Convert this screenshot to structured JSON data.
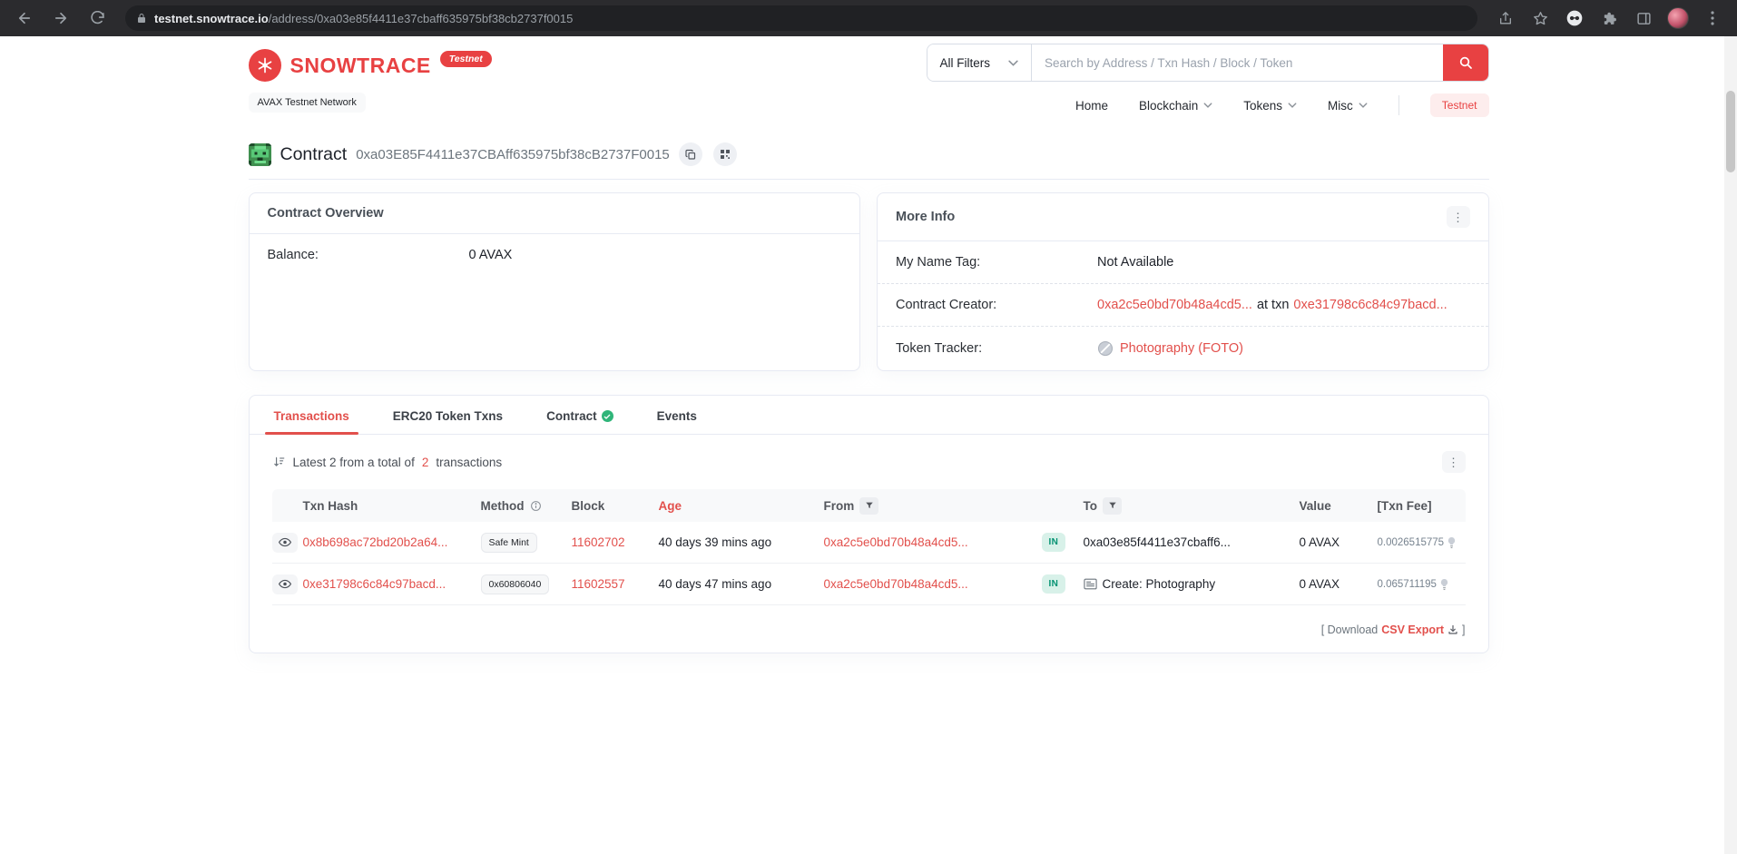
{
  "colors": {
    "brand_red": "#e84142",
    "link_red": "#e2504c",
    "in_badge_bg": "#d8f1e9",
    "in_badge_text": "#029171"
  },
  "browser": {
    "url_host": "testnet.snowtrace.io",
    "url_path": "/address/0xa03e85f4411e37cbaff635975bf38cb2737f0015"
  },
  "header": {
    "brand": "SNOWTRACE",
    "brand_badge": "Testnet",
    "network_label": "AVAX Testnet Network",
    "search": {
      "filter_label": "All Filters",
      "placeholder": "Search by Address / Txn Hash / Block / Token"
    },
    "nav": [
      {
        "label": "Home"
      },
      {
        "label": "Blockchain"
      },
      {
        "label": "Tokens"
      },
      {
        "label": "Misc"
      }
    ],
    "nav_testnet": "Testnet"
  },
  "page": {
    "title": "Contract",
    "address": "0xa03E85F4411e37CBAff635975bf38cB2737F0015"
  },
  "overview": {
    "title": "Contract Overview",
    "balance_label": "Balance:",
    "balance_value": "0 AVAX"
  },
  "more_info": {
    "title": "More Info",
    "dots_glyph": "⋮",
    "name_tag_label": "My Name Tag:",
    "name_tag_value": "Not Available",
    "creator_label": "Contract Creator:",
    "creator_address": "0xa2c5e0bd70b48a4cd5...",
    "creator_at_txn": "at txn",
    "creator_txn": "0xe31798c6c84c97bacd...",
    "tracker_label": "Token Tracker:",
    "tracker_value": "Photography (FOTO)"
  },
  "tabs": [
    {
      "label": "Transactions"
    },
    {
      "label": "ERC20 Token Txns"
    },
    {
      "label": "Contract"
    },
    {
      "label": "Events"
    }
  ],
  "transactions": {
    "summary_prefix": "Latest 2 from a total of",
    "summary_total": "2",
    "summary_suffix": "transactions",
    "dots_glyph": "⋮",
    "columns": {
      "txn_hash": "Txn Hash",
      "method": "Method",
      "block": "Block",
      "age": "Age",
      "from": "From",
      "to": "To",
      "value": "Value",
      "txn_fee": "[Txn Fee]"
    },
    "rows": [
      {
        "hash": "0x8b698ac72bd20b2a64...",
        "method": "Safe Mint",
        "block": "11602702",
        "age": "40 days 39 mins ago",
        "from": "0xa2c5e0bd70b48a4cd5...",
        "direction": "IN",
        "to": "0xa03e85f4411e37cbaff6...",
        "value": "0 AVAX",
        "fee": "0.0026515775"
      },
      {
        "hash": "0xe31798c6c84c97bacd...",
        "method": "0x60806040",
        "block": "11602557",
        "age": "40 days 47 mins ago",
        "from": "0xa2c5e0bd70b48a4cd5...",
        "direction": "IN",
        "to": "Create: Photography",
        "value": "0 AVAX",
        "fee": "0.065711195"
      }
    ],
    "download_open": "[ Download",
    "download_link": "CSV Export",
    "download_close": "]"
  }
}
